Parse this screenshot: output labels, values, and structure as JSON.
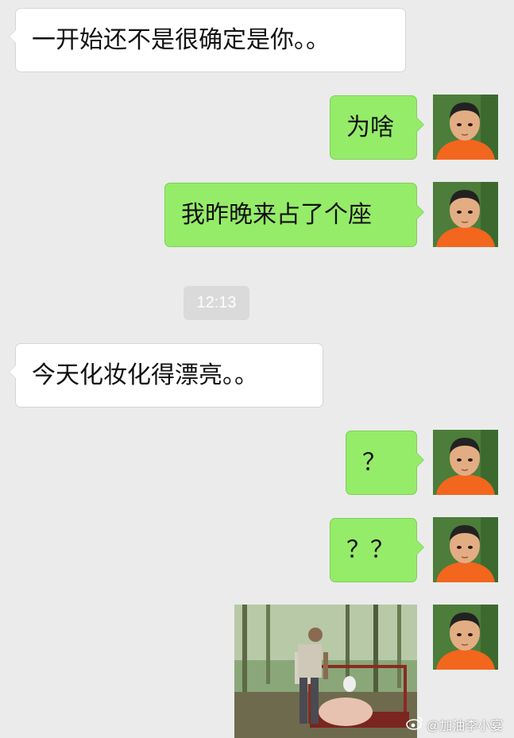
{
  "chat": {
    "messages": [
      {
        "side": "left",
        "text": "一开始还不是很确定是你。。"
      },
      {
        "side": "right",
        "text": "为啥"
      },
      {
        "side": "right",
        "text": "我昨晚来占了个座"
      },
      {
        "side": "left",
        "text": "今天化妆化得漂亮。。"
      },
      {
        "side": "right",
        "text": "？"
      },
      {
        "side": "right",
        "text": "？？"
      }
    ],
    "timestamp": "12:13"
  },
  "watermark": {
    "icon": "weibo-icon",
    "text": "@加油李小宴"
  },
  "colors": {
    "background": "#ebebeb",
    "incoming_bubble": "#ffffff",
    "outgoing_bubble": "#95ec69",
    "timestamp_bg": "#dadada"
  }
}
